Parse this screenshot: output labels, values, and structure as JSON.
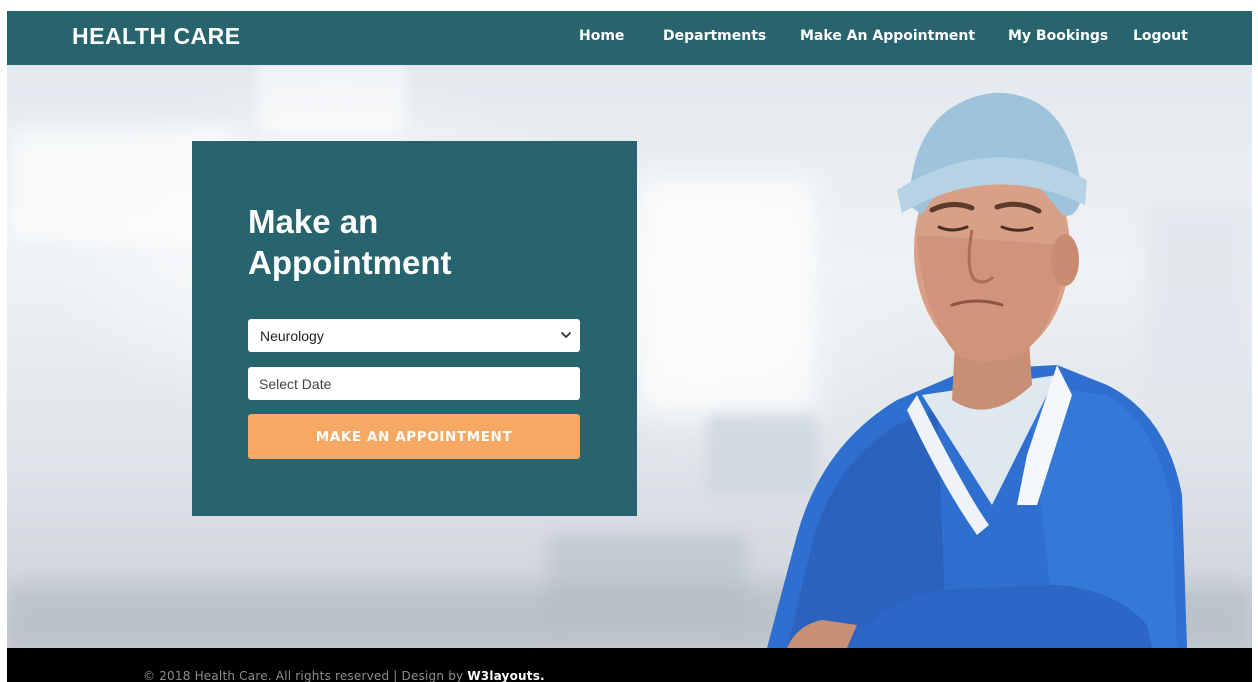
{
  "header": {
    "logo": "HEALTH CARE",
    "nav": [
      {
        "label": "Home"
      },
      {
        "label": "Departments"
      },
      {
        "label": "Make An Appointment"
      },
      {
        "label": "My Bookings"
      },
      {
        "label": "Logout"
      }
    ]
  },
  "appointment": {
    "title": "Make an Appointment",
    "department_selected": "Neurology",
    "date_placeholder": "Select Date",
    "submit_label": "MAKE AN APPOINTMENT"
  },
  "footer": {
    "copyright": "© 2018 Health Care. All rights reserved | Design by ",
    "credit_link": "W3layouts",
    "credit_suffix": "."
  },
  "colors": {
    "primary": "#27646d",
    "accent": "#f5a962",
    "footer_bg": "#000000"
  },
  "icons": {
    "select_chevron": "chevron-down-icon"
  }
}
